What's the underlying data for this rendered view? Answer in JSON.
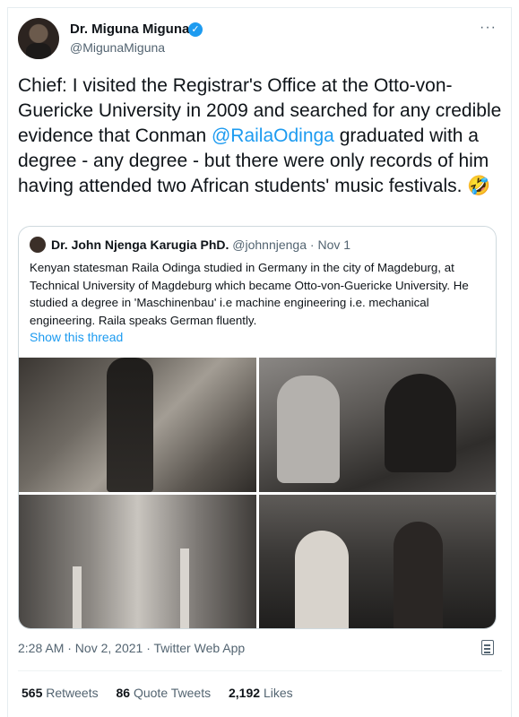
{
  "tweet": {
    "author_name": "Dr. Miguna Miguna",
    "author_handle": "@MigunaMiguna",
    "more_glyph": "···",
    "text_before": "Chief: I visited the Registrar's Office at the Otto-von-Guericke University in 2009 and searched for any credible evidence that Conman ",
    "mention": "@RailaOdinga",
    "text_after": " graduated with a degree - any degree - but there were only records of him having attended two African students' music festivals. 🤣",
    "timestamp": "2:28 AM · Nov 2, 2021 · Twitter Web App"
  },
  "quote": {
    "name": "Dr. John Njenga Karugia PhD.",
    "handle": "@johnnjenga",
    "dot": "·",
    "date": "Nov 1",
    "text": "Kenyan statesman Raila Odinga studied in Germany in the city of Magdeburg, at Technical University of Magdeburg which became Otto-von-Guericke University. He studied a degree in 'Maschinenbau' i.e machine engineering i.e. mechanical engineering. Raila speaks German fluently.",
    "show_thread": "Show this thread"
  },
  "stats": {
    "retweets_num": "565",
    "retweets_label": "Retweets",
    "quotes_num": "86",
    "quotes_label": "Quote Tweets",
    "likes_num": "2,192",
    "likes_label": "Likes"
  },
  "icons": {
    "verified": "verified-badge-icon",
    "analytics": "view-analytics-icon"
  },
  "colors": {
    "link": "#1d9bf0",
    "secondary_text": "#536471",
    "border": "#cfd9de"
  }
}
